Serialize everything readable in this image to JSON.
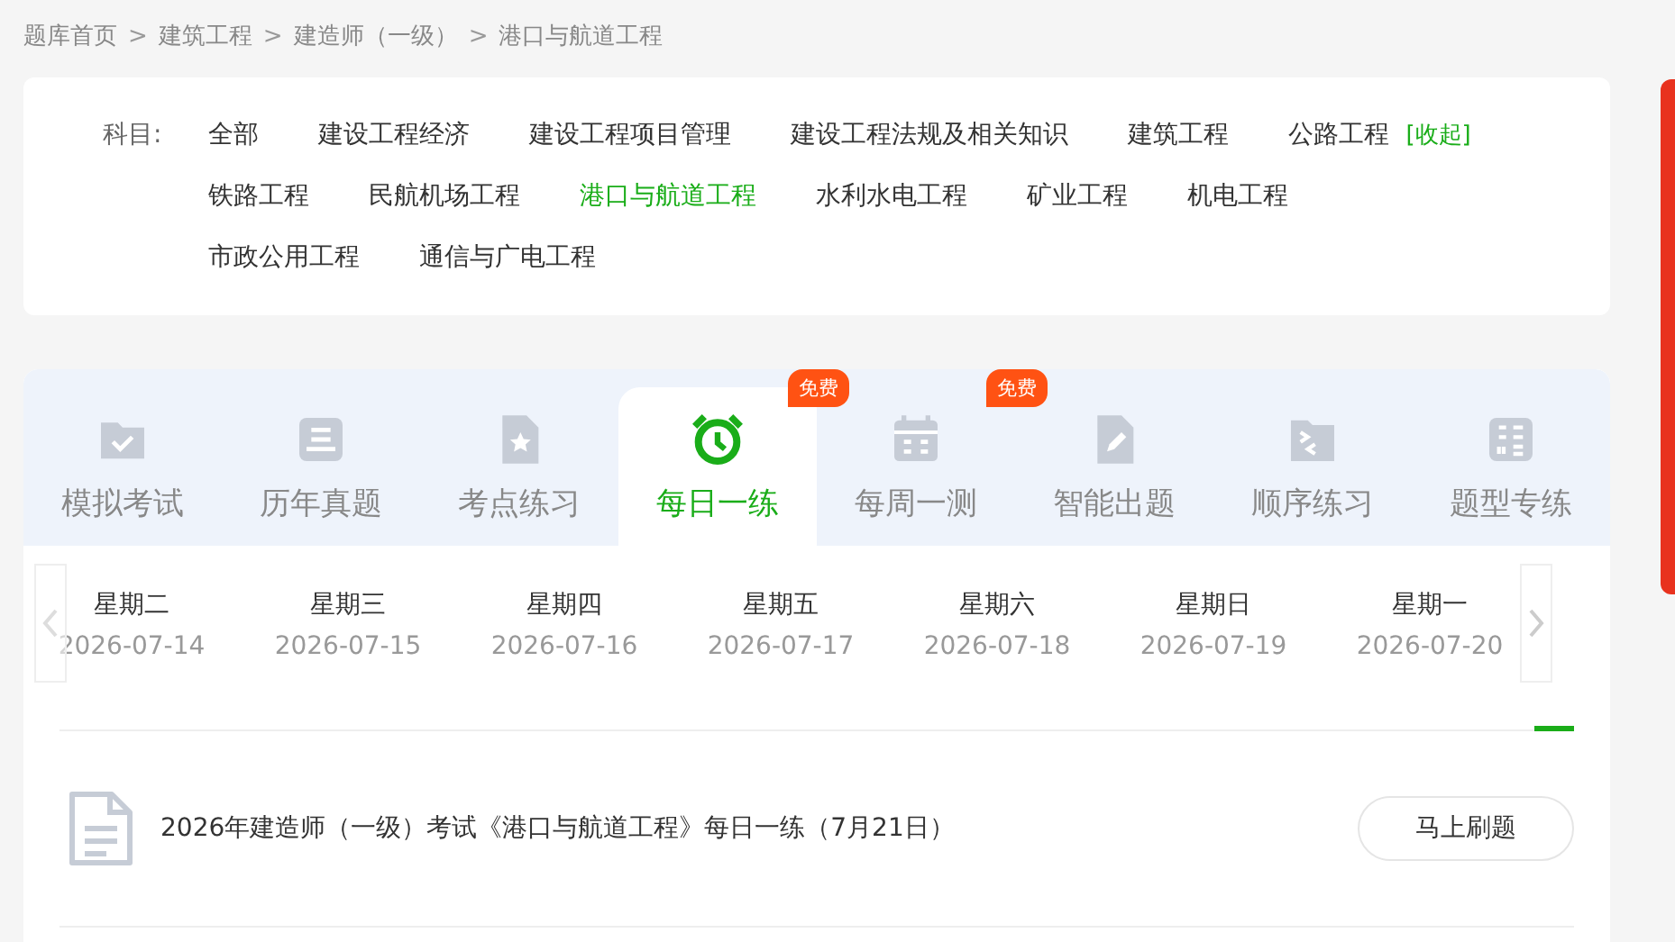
{
  "breadcrumb": {
    "separator": ">",
    "items": [
      "题库首页",
      "建筑工程",
      "建造师（一级）",
      "港口与航道工程"
    ]
  },
  "subjects": {
    "label": "科目:",
    "rows": [
      [
        {
          "label": "全部",
          "selected": false
        },
        {
          "label": "建设工程经济",
          "selected": false
        },
        {
          "label": "建设工程项目管理",
          "selected": false
        },
        {
          "label": "建设工程法规及相关知识",
          "selected": false
        },
        {
          "label": "建筑工程",
          "selected": false
        },
        {
          "label": "公路工程",
          "selected": false
        }
      ],
      [
        {
          "label": "铁路工程",
          "selected": false
        },
        {
          "label": "民航机场工程",
          "selected": false
        },
        {
          "label": "港口与航道工程",
          "selected": true
        },
        {
          "label": "水利水电工程",
          "selected": false
        },
        {
          "label": "矿业工程",
          "selected": false
        },
        {
          "label": "机电工程",
          "selected": false
        }
      ],
      [
        {
          "label": "市政公用工程",
          "selected": false
        },
        {
          "label": "通信与广电工程",
          "selected": false
        }
      ]
    ],
    "collapse": "[收起]"
  },
  "tabs": [
    {
      "label": "模拟考试",
      "kind": "folder",
      "selected": false
    },
    {
      "label": "历年真题",
      "kind": "list",
      "selected": false
    },
    {
      "label": "考点练习",
      "kind": "star",
      "selected": false
    },
    {
      "label": "每日一练",
      "kind": "clock",
      "selected": true,
      "badge": "免费"
    },
    {
      "label": "每周一测",
      "kind": "calendar",
      "selected": false,
      "badge": "免费"
    },
    {
      "label": "智能出题",
      "kind": "pen",
      "selected": false
    },
    {
      "label": "顺序练习",
      "kind": "code",
      "selected": false
    },
    {
      "label": "题型专练",
      "kind": "grid",
      "selected": false
    }
  ],
  "days": [
    {
      "weekday": "星期二",
      "date": "2026-07-14"
    },
    {
      "weekday": "星期三",
      "date": "2026-07-15"
    },
    {
      "weekday": "星期四",
      "date": "2026-07-16"
    },
    {
      "weekday": "星期五",
      "date": "2026-07-17"
    },
    {
      "weekday": "星期六",
      "date": "2026-07-18"
    },
    {
      "weekday": "星期日",
      "date": "2026-07-19"
    },
    {
      "weekday": "星期一",
      "date": "2026-07-20"
    }
  ],
  "exercise": {
    "title": "2026年建造师（一级）考试《港口与航道工程》每日一练（7月21日）",
    "button": "马上刷题"
  }
}
